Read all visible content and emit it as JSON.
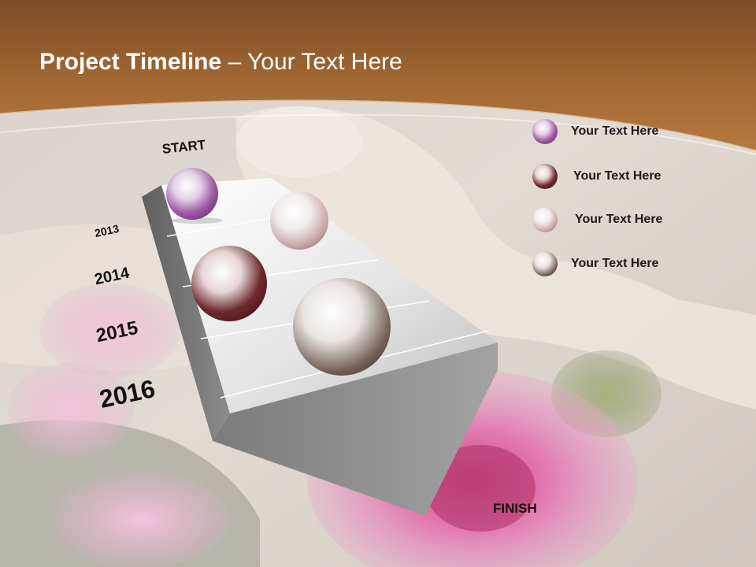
{
  "slide": {
    "title_bold": "Project Timeline",
    "title_rest": " – Your Text Here",
    "start_label": "START",
    "finish_label": "FINISH",
    "years": [
      "2013",
      "2014",
      "2015",
      "2016"
    ],
    "legend": [
      {
        "text": "Your  Text Here",
        "color": "#8a4f8f"
      },
      {
        "text": "Your  Text Here",
        "color": "#5e1e24"
      },
      {
        "text": "Your  Text Here",
        "color": "#b08a8a"
      },
      {
        "text": "Your  Text Here",
        "color": "#5b4c45"
      }
    ]
  },
  "colors": {
    "banner": "#9c6331",
    "banner_light": "#b87a3c",
    "board_light": "#f0f0f0",
    "board_dark": "#8e8e8e",
    "flower_pink": "#e070b0"
  }
}
